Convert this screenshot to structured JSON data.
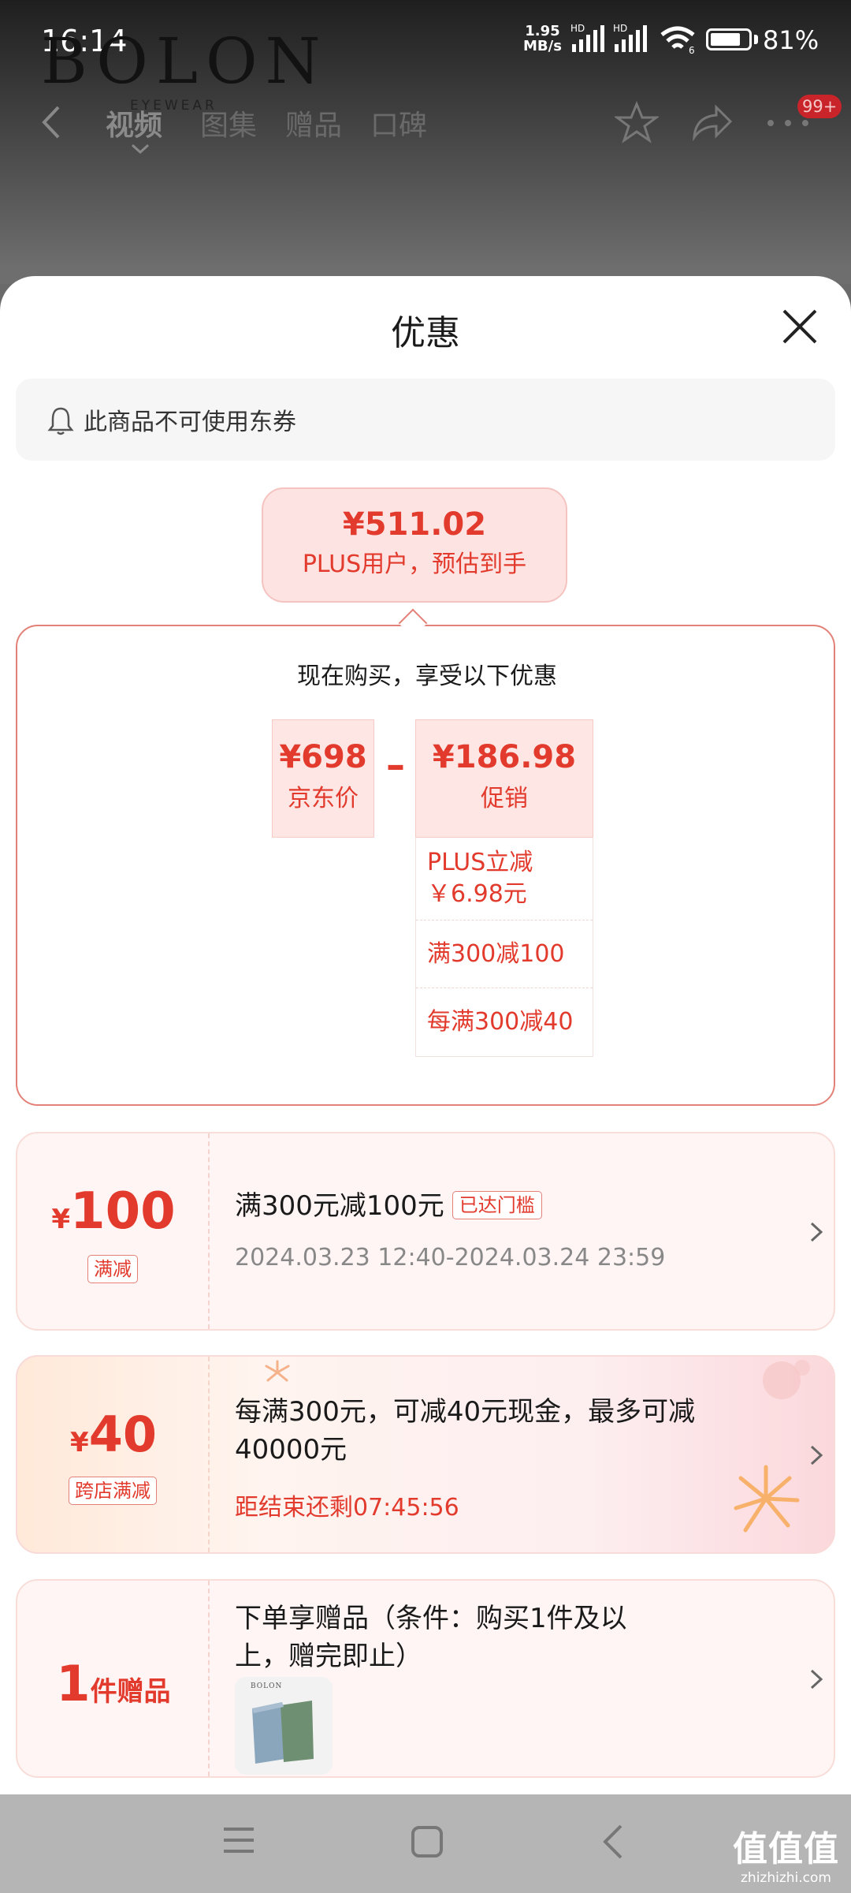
{
  "status_bar": {
    "time": "16:14",
    "net_speed_value": "1.95",
    "net_speed_unit": "MB/s",
    "hd1": "HD",
    "hd2": "HD",
    "wifi_sub": "6",
    "battery": "81%",
    "battery_level": 0.81
  },
  "background_page": {
    "brand": "BOLON",
    "brand_sub": "EYEWEAR",
    "tabs": [
      "视频",
      "图集",
      "赠品",
      "口碑"
    ],
    "badge": "99+"
  },
  "sheet": {
    "title": "优惠",
    "notice": "此商品不可使用东券",
    "estimate": {
      "price": "¥511.02",
      "label": "PLUS用户，预估到手"
    },
    "calc": {
      "heading": "现在购买，享受以下优惠",
      "jd_price": "¥698",
      "jd_label": "京东价",
      "minus": "–",
      "promo_price": "¥186.98",
      "promo_label": "促销",
      "promo_items": [
        "PLUS立减 ￥6.98元",
        "满300减100",
        "每满300减40"
      ]
    },
    "cards": [
      {
        "currency": "¥",
        "amount": "100",
        "tag": "满减",
        "title": "满300元减100元",
        "status": "已达门槛",
        "subtitle": "2024.03.23 12:40-2024.03.24 23:59"
      },
      {
        "currency": "¥",
        "amount": "40",
        "tag": "跨店满减",
        "title": "每满300元，可减40元现金，最多可减40000元",
        "subtitle": "距结束还剩07:45:56"
      },
      {
        "amount": "1",
        "unit": "件赠品",
        "title": "下单享赠品（条件：购买1件及以上，赠完即止）",
        "thumb_brand": "BOLON"
      }
    ]
  },
  "watermark": {
    "main": "值值值",
    "sub": "zhizhizhi.com"
  },
  "colors": {
    "accent": "#e23a2c",
    "card_bg": "#fff5f4",
    "nav_bar": "#b5b5b5"
  }
}
